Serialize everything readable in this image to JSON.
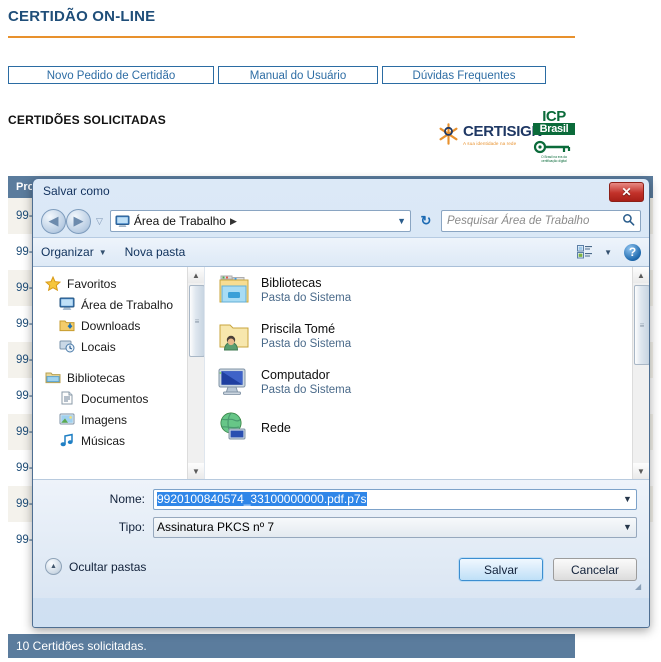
{
  "web": {
    "title": "CERTIDÃO ON-LINE",
    "section_title": "CERTIDÕES SOLICITADAS",
    "accent_color": "#e8912d",
    "title_color": "#1f4e79",
    "header_bg": "#5b7c9d",
    "tabs": [
      {
        "label": "Novo Pedido de Certidão"
      },
      {
        "label": "Manual do Usuário"
      },
      {
        "label": "Dúvidas Frequentes"
      }
    ],
    "logos": {
      "certisign_word": "CERTISIGN",
      "certisign_tagline": "A sua identidade na rede",
      "icp_top": "ICP",
      "icp_brasil": "Brasil",
      "icp_caption": "O Brasil na era da certificação digital"
    },
    "table": {
      "columns": [
        "Pro"
      ],
      "rows": [
        {
          "col0": "99-"
        },
        {
          "col0": "99-"
        },
        {
          "col0": "99-"
        },
        {
          "col0": "99-"
        },
        {
          "col0": "99-"
        },
        {
          "col0": "99-"
        },
        {
          "col0": "99-"
        },
        {
          "col0": "99-"
        },
        {
          "col0": "99-"
        },
        {
          "col0": "99-"
        }
      ]
    },
    "status": "10 Certidões solicitadas."
  },
  "dialog": {
    "title": "Salvar como",
    "close_label": "✕",
    "address": {
      "icon": "desktop-icon",
      "path": "Área de Trabalho",
      "separator": "▶",
      "dropdown_caret": "▼",
      "refresh_glyph": "↻"
    },
    "search": {
      "placeholder": "Pesquisar Área de Trabalho",
      "icon": "magnifier-icon"
    },
    "commandbar": {
      "organize": "Organizar",
      "organize_caret": "▼",
      "new_folder": "Nova pasta",
      "view_caret": "▼",
      "help_glyph": "?"
    },
    "navpane": [
      {
        "label": "Favoritos",
        "icon": "star-icon",
        "level": 0
      },
      {
        "label": "Área de Trabalho",
        "icon": "desktop-icon",
        "level": 1
      },
      {
        "label": "Downloads",
        "icon": "downloads-folder-icon",
        "level": 1
      },
      {
        "label": "Locais",
        "icon": "recent-places-icon",
        "level": 1
      },
      {
        "label": "Bibliotecas",
        "icon": "libraries-icon",
        "level": 0
      },
      {
        "label": "Documentos",
        "icon": "documents-icon",
        "level": 1
      },
      {
        "label": "Imagens",
        "icon": "pictures-icon",
        "level": 1
      },
      {
        "label": "Músicas",
        "icon": "music-icon",
        "level": 1
      }
    ],
    "files": [
      {
        "name": "Bibliotecas",
        "sub": "Pasta do Sistema",
        "icon": "libraries-folder-icon"
      },
      {
        "name": "Priscila Tomé",
        "sub": "Pasta do Sistema",
        "icon": "user-folder-icon"
      },
      {
        "name": "Computador",
        "sub": "Pasta do Sistema",
        "icon": "computer-icon"
      },
      {
        "name": "Rede",
        "sub": "",
        "icon": "network-icon"
      }
    ],
    "fields": {
      "name_label": "Nome:",
      "name_value": "9920100840574_33100000000.pdf.p7s",
      "type_label": "Tipo:",
      "type_value": "Assinatura PKCS nº 7",
      "caret": "▼"
    },
    "footer": {
      "hide_folders": "Ocultar pastas",
      "hide_folders_glyph": "▲",
      "save": "Salvar",
      "cancel": "Cancelar"
    },
    "scroll": {
      "up_glyph": "▲",
      "down_glyph": "▼",
      "grip_glyph": "≡"
    }
  }
}
